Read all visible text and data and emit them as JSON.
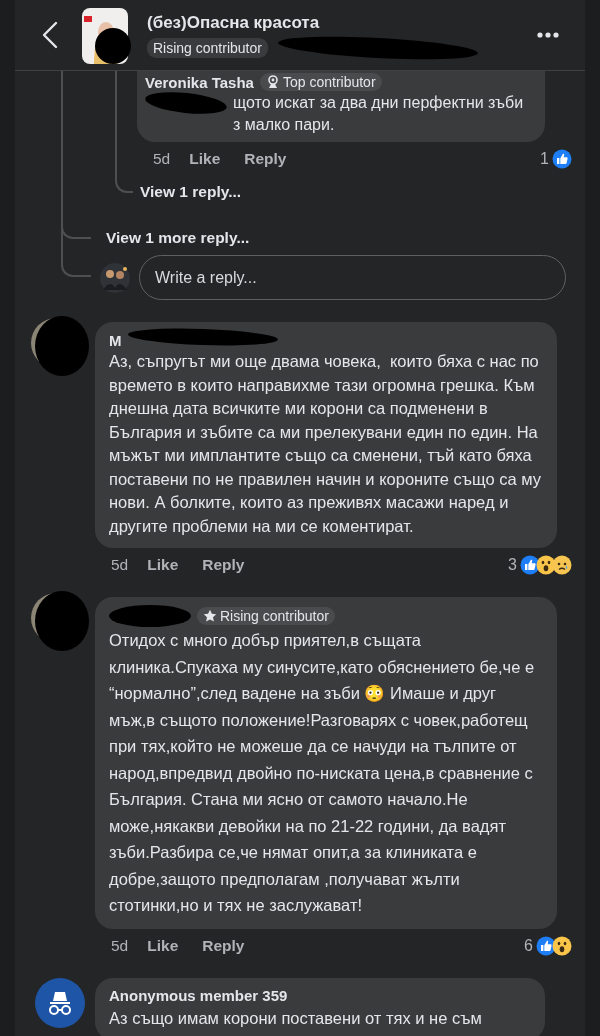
{
  "header": {
    "title": "(без)Опасна красота",
    "badge": "Rising contributor"
  },
  "reply": {
    "author": "Veronika Tasha",
    "badge": "Top contributor",
    "text": "щото искат за два дни перфектни зъби з малко пари.",
    "time": "5d",
    "like": "Like",
    "reply": "Reply",
    "count": "1",
    "reactions": [
      {
        "kind": "like"
      }
    ]
  },
  "view_replies": "View 1 reply...",
  "view_more": "View 1 more reply...",
  "reply_field": {
    "placeholder": "Write a reply..."
  },
  "comments": [
    {
      "kind": "redacted",
      "author": "M",
      "text": "Аз, съпругът ми още двама човека,  които бяха с нас по времето в които направихме тази огромна грешка. Към днешна дата всичките ми корони са подменени в България и зъбите са ми прелекувани един по един. На мъжът ми имплантите също са сменени, тъй като бяха поставени по не правилен начин и короните също са му нови. А болките, които аз преживях масажи наред и другите проблеми на ми се коментират.",
      "time": "5d",
      "like": "Like",
      "reply": "Reply",
      "count": "3",
      "reactions": [
        {
          "kind": "like"
        },
        {
          "kind": "wow"
        },
        {
          "kind": "sad"
        }
      ]
    },
    {
      "kind": "redacted",
      "badge": "Rising contributor",
      "text": "Отидох с много добър приятел,в същата клиника.Спукаха му синусите,като обяснението бе,че е “нормално”,след вадене на зъби 😳 Имаше и друг мъж,в същото положение!Разговарях с човек,работещ при тях,който не можеше да се начуди на тълпите от народ,впредвид двойно по-ниската цена,в сравнение с България. Стана ми ясно от самото начало.Не може,някакви девойки на по 21-22 години, да вадят зъби.Разбира се,че нямат опит,а за клиниката е добре,защото предполагам ,получават жълти стотинки,но и тях не заслужават!",
      "time": "5d",
      "like": "Like",
      "reply": "Reply",
      "count": "6",
      "reactions": [
        {
          "kind": "like"
        },
        {
          "kind": "wow"
        }
      ]
    },
    {
      "kind": "anonymous",
      "author": "Anonymous member 359",
      "text": "Аз също имам корони поставени от тях и не съм"
    }
  ]
}
